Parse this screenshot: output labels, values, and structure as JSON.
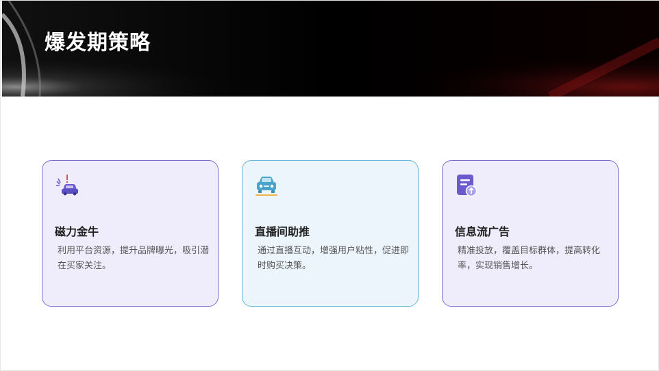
{
  "slide": {
    "title": "爆发期策略"
  },
  "cards": [
    {
      "title": "磁力金牛",
      "desc": "利用平台资源，提升品牌曝光，吸引潜在买家关注。",
      "icon": "car-crash-icon",
      "theme": "purple",
      "accent": "#6a5acd"
    },
    {
      "title": "直播间助推",
      "desc": "通过直播互动，增强用户粘性，促进即时购买决策。",
      "icon": "car-front-icon",
      "theme": "blue",
      "accent": "#4aa3c8"
    },
    {
      "title": "信息流广告",
      "desc": "精准投放，覆盖目标群体，提高转化率，实现销售增长。",
      "icon": "document-upload-icon",
      "theme": "purple",
      "accent": "#6a5acd"
    }
  ]
}
